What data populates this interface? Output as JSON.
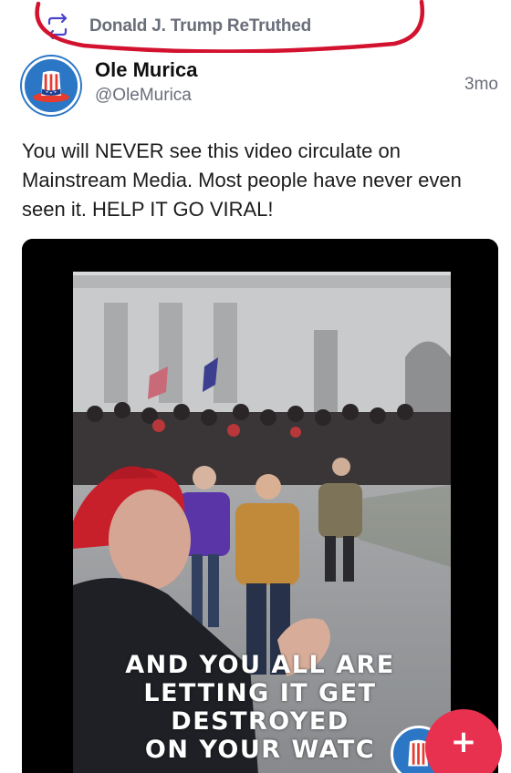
{
  "retruth": {
    "label": "Donald J. Trump ReTruthed",
    "icon": "retruth-icon"
  },
  "post": {
    "author": {
      "display_name": "Ole Murica",
      "handle": "@OleMurica",
      "avatar_icon": "uncle-sam-hat-avatar"
    },
    "timestamp": "3mo",
    "text": "You will NEVER see this video circulate on Mainstream Media. Most people have never even seen it. HELP IT GO VIRAL!",
    "media": {
      "caption_lines": [
        "AND YOU ALL ARE",
        "LETTING IT GET",
        "DESTROYED",
        "ON YOUR WATC"
      ]
    }
  },
  "fab": {
    "label": "+",
    "icon": "compose-plus-icon"
  },
  "colors": {
    "accent": "#e8304f",
    "retruth_icon": "#4b43c9",
    "annotation": "#d3122f",
    "avatar_bg": "#2c76c6"
  }
}
